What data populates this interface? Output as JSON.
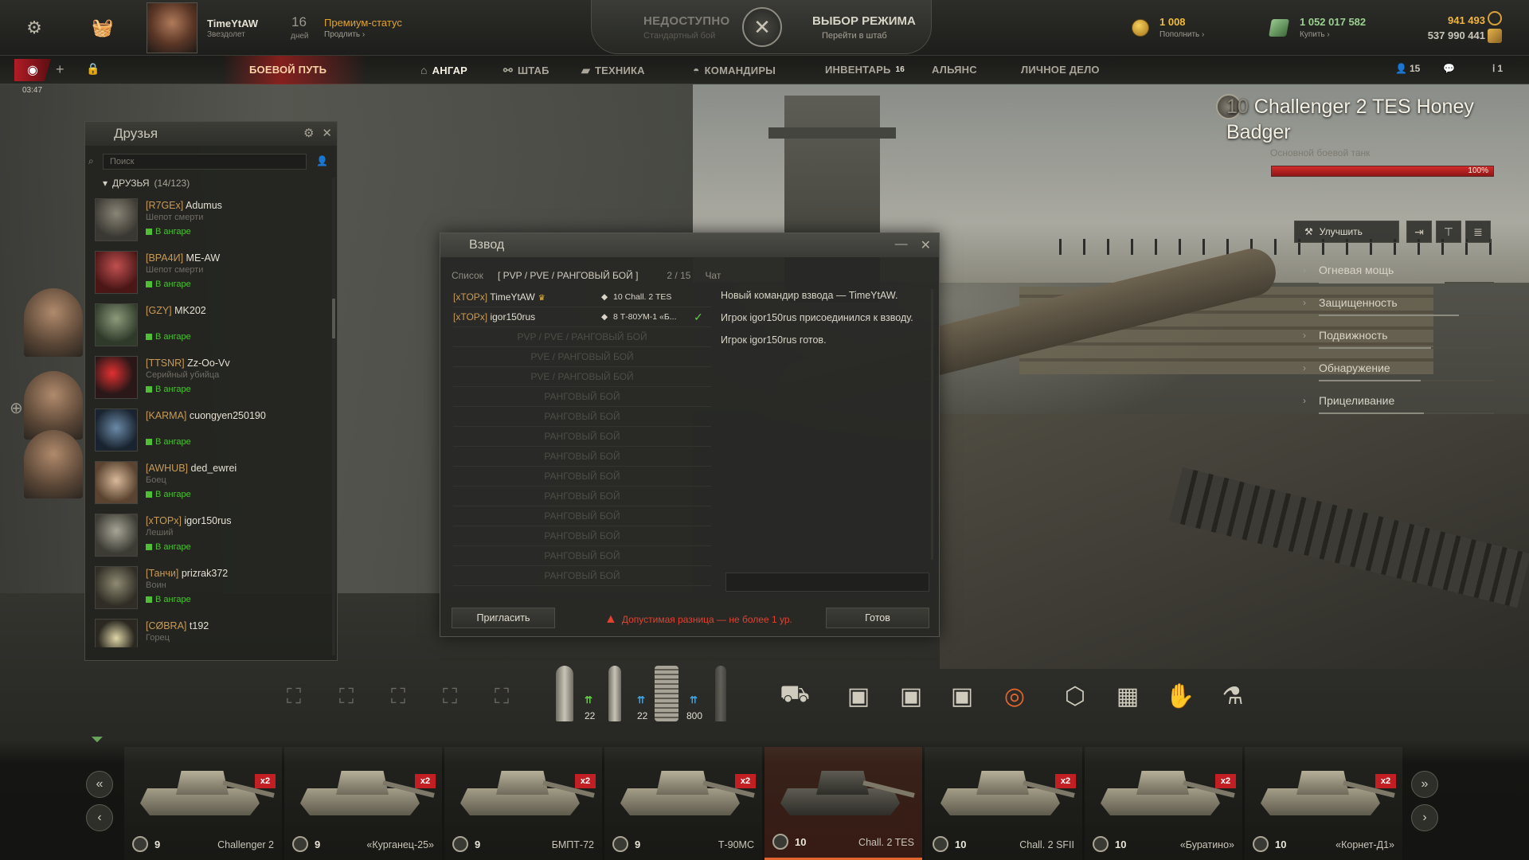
{
  "topbar": {
    "player_name": "TimeYtAW",
    "player_rank": "Звездолет",
    "premium_days": "16",
    "premium_days_label": "дней",
    "premium_status": "Премиум-статус",
    "premium_extend": "Продлить",
    "mode_unavailable": "НЕДОСТУПНО",
    "mode_unavailable_sub": "Стандартный бой",
    "mode_select": "ВЫБОР РЕЖИМА",
    "mode_select_sub": "Перейти в штаб",
    "gold_value": "1 008",
    "gold_action": "Пополнить",
    "credits_value": "1 052 017 582",
    "credits_action": "Купить",
    "free_xp": "941 493",
    "bonds": "537 990 441"
  },
  "nav": {
    "clock": "03:47",
    "battle_pass": "БОЕВОЙ ПУТЬ",
    "hangar": "АНГАР",
    "hq": "ШТАБ",
    "tech": "ТЕХНИКА",
    "commanders": "КОМАНДИРЫ",
    "inventory": "ИНВЕНТАРЬ",
    "inventory_badge": "16",
    "alliance": "АЛЬЯНС",
    "profile": "ЛИЧНОЕ ДЕЛО",
    "friends_count": "15",
    "notif_count": "1"
  },
  "friends": {
    "title": "Друзья",
    "search_placeholder": "Поиск",
    "group_label": "ДРУЗЬЯ",
    "group_count": "(14/123)",
    "items": [
      {
        "clan": "[R7GEx]",
        "name": "Adumus",
        "rank": "Шепот смерти",
        "status": "В ангаре"
      },
      {
        "clan": "[ВРА4И]",
        "name": "ME-AW",
        "rank": "Шепот смерти",
        "status": "В ангаре"
      },
      {
        "clan": "[GZY]",
        "name": "MK202",
        "rank": "",
        "status": "В ангаре"
      },
      {
        "clan": "[TTSNR]",
        "name": "Zz-Oo-Vv",
        "rank": "Серийный убийца",
        "status": "В ангаре"
      },
      {
        "clan": "[KARMA]",
        "name": "cuongyen250190",
        "rank": "",
        "status": "В ангаре"
      },
      {
        "clan": "[AWHUB]",
        "name": "ded_ewrei",
        "rank": "Боец",
        "status": "В ангаре"
      },
      {
        "clan": "[xTOPx]",
        "name": "igor150rus",
        "rank": "Леший",
        "status": "В ангаре"
      },
      {
        "clan": "[Танчи]",
        "name": "prizrak372",
        "rank": "Воин",
        "status": "В ангаре"
      },
      {
        "clan": "[CØBRA]",
        "name": "t192",
        "rank": "Горец",
        "status": ""
      }
    ]
  },
  "platoon": {
    "title": "Взвод",
    "tab_list": "Список",
    "tab_mode": "[ PVP / PVE / РАНГОВЫЙ БОЙ ]",
    "tab_count": "2 / 15",
    "tab_chat": "Чат",
    "members": [
      {
        "clan": "[xTOPx]",
        "name": "TimeYtAW",
        "tier": "10",
        "vehicle": "Chall. 2 TES"
      },
      {
        "clan": "[xTOPx]",
        "name": "igor150rus",
        "tier": "8",
        "vehicle": "Т-80УМ-1 «Б..."
      }
    ],
    "empty_slots": [
      "PVP / PVE / РАНГОВЫЙ БОЙ",
      "PVE / РАНГОВЫЙ БОЙ",
      "PVE / РАНГОВЫЙ БОЙ",
      "РАНГОВЫЙ БОЙ",
      "РАНГОВЫЙ БОЙ",
      "РАНГОВЫЙ БОЙ",
      "РАНГОВЫЙ БОЙ",
      "РАНГОВЫЙ БОЙ",
      "РАНГОВЫЙ БОЙ",
      "РАНГОВЫЙ БОЙ",
      "РАНГОВЫЙ БОЙ",
      "РАНГОВЫЙ БОЙ",
      "РАНГОВЫЙ БОЙ"
    ],
    "chat": [
      "Новый командир взвода — TimeYtAW.",
      "Игрок igor150rus присоединился к взводу.",
      "Игрок igor150rus готов."
    ],
    "invite_label": "Пригласить",
    "warning": "Допустимая разница — не более 1 ур.",
    "ready_label": "Готов"
  },
  "vehicle": {
    "tier": "10",
    "name": "Challenger 2 TES Honey Badger",
    "type": "Основной боевой танк",
    "hp_percent": 100,
    "hp_label": "100%",
    "upgrade_label": "Улучшить",
    "params": [
      {
        "label": "Огневая мощь",
        "level": 0.72
      },
      {
        "label": "Защищенность",
        "level": 0.8
      },
      {
        "label": "Подвижность",
        "level": 0.64
      },
      {
        "label": "Обнаружение",
        "level": 0.58
      },
      {
        "label": "Прицеливание",
        "level": 0.6
      }
    ]
  },
  "ammo": {
    "count1": "22",
    "count2": "22",
    "count3": "800"
  },
  "carousel": [
    {
      "tier": "9",
      "name": "Challenger 2",
      "bonus": "x2"
    },
    {
      "tier": "9",
      "name": "«Курганец-25»",
      "bonus": "x2"
    },
    {
      "tier": "9",
      "name": "БМПТ-72",
      "bonus": "x2"
    },
    {
      "tier": "9",
      "name": "Т-90МС",
      "bonus": "x2"
    },
    {
      "tier": "10",
      "name": "Chall. 2 TES",
      "bonus": "x2"
    },
    {
      "tier": "10",
      "name": "Chall. 2 SFII",
      "bonus": "x2"
    },
    {
      "tier": "10",
      "name": "«Буратино»",
      "bonus": "x2"
    },
    {
      "tier": "10",
      "name": "«Корнет-Д1»",
      "bonus": "x2"
    }
  ],
  "colors": {
    "accent_red": "#c21f24",
    "online_green": "#4fbf36",
    "gold": "#f2bc3c",
    "credits": "#9bd190"
  }
}
